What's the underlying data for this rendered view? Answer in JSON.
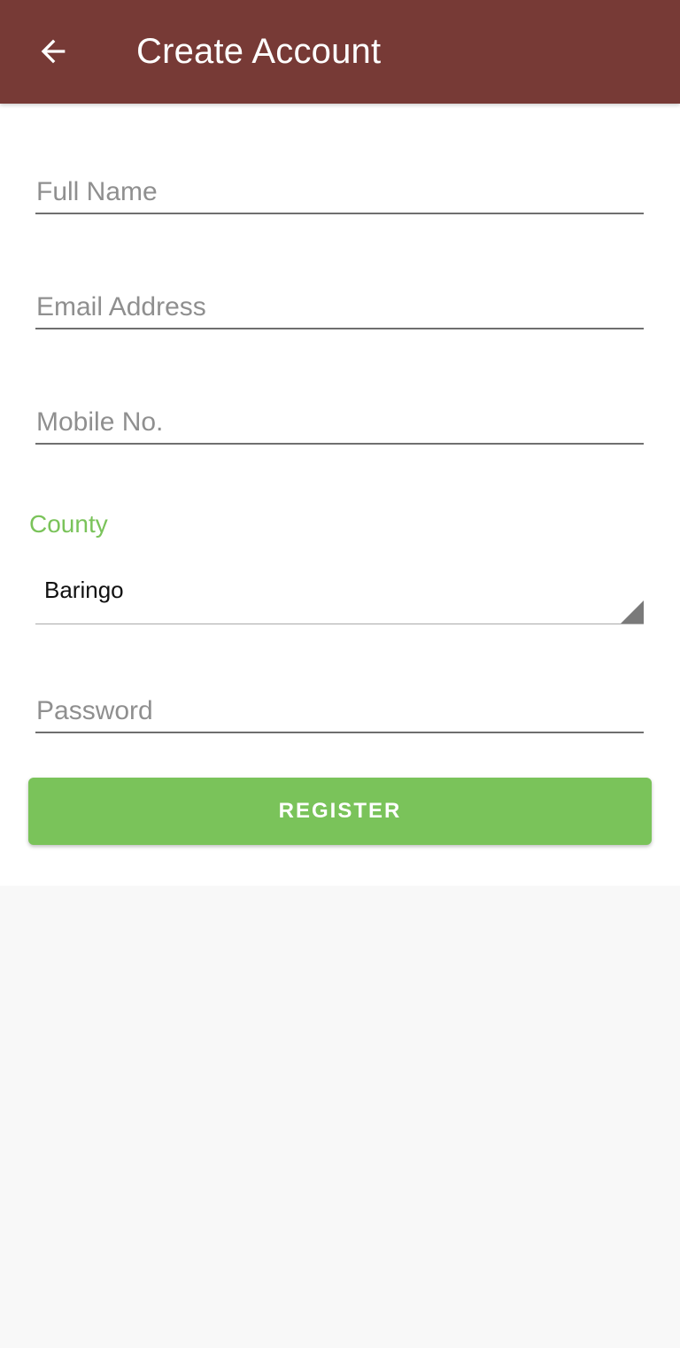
{
  "app_bar": {
    "title": "Create Account",
    "back_icon": "arrow-back-icon",
    "background_color": "#773a36"
  },
  "form": {
    "full_name": {
      "placeholder": "Full Name",
      "value": ""
    },
    "email": {
      "placeholder": "Email Address",
      "value": ""
    },
    "mobile": {
      "placeholder": "Mobile No.",
      "value": ""
    },
    "county": {
      "label": "County",
      "selected": "Baringo",
      "arrow_icon": "spinner-triangle-icon"
    },
    "password": {
      "placeholder": "Password",
      "value": ""
    },
    "register_label": "REGISTER"
  },
  "colors": {
    "accent": "#7ac35a",
    "underline": "#6f6f6f",
    "placeholder": "#8f8f8f"
  }
}
